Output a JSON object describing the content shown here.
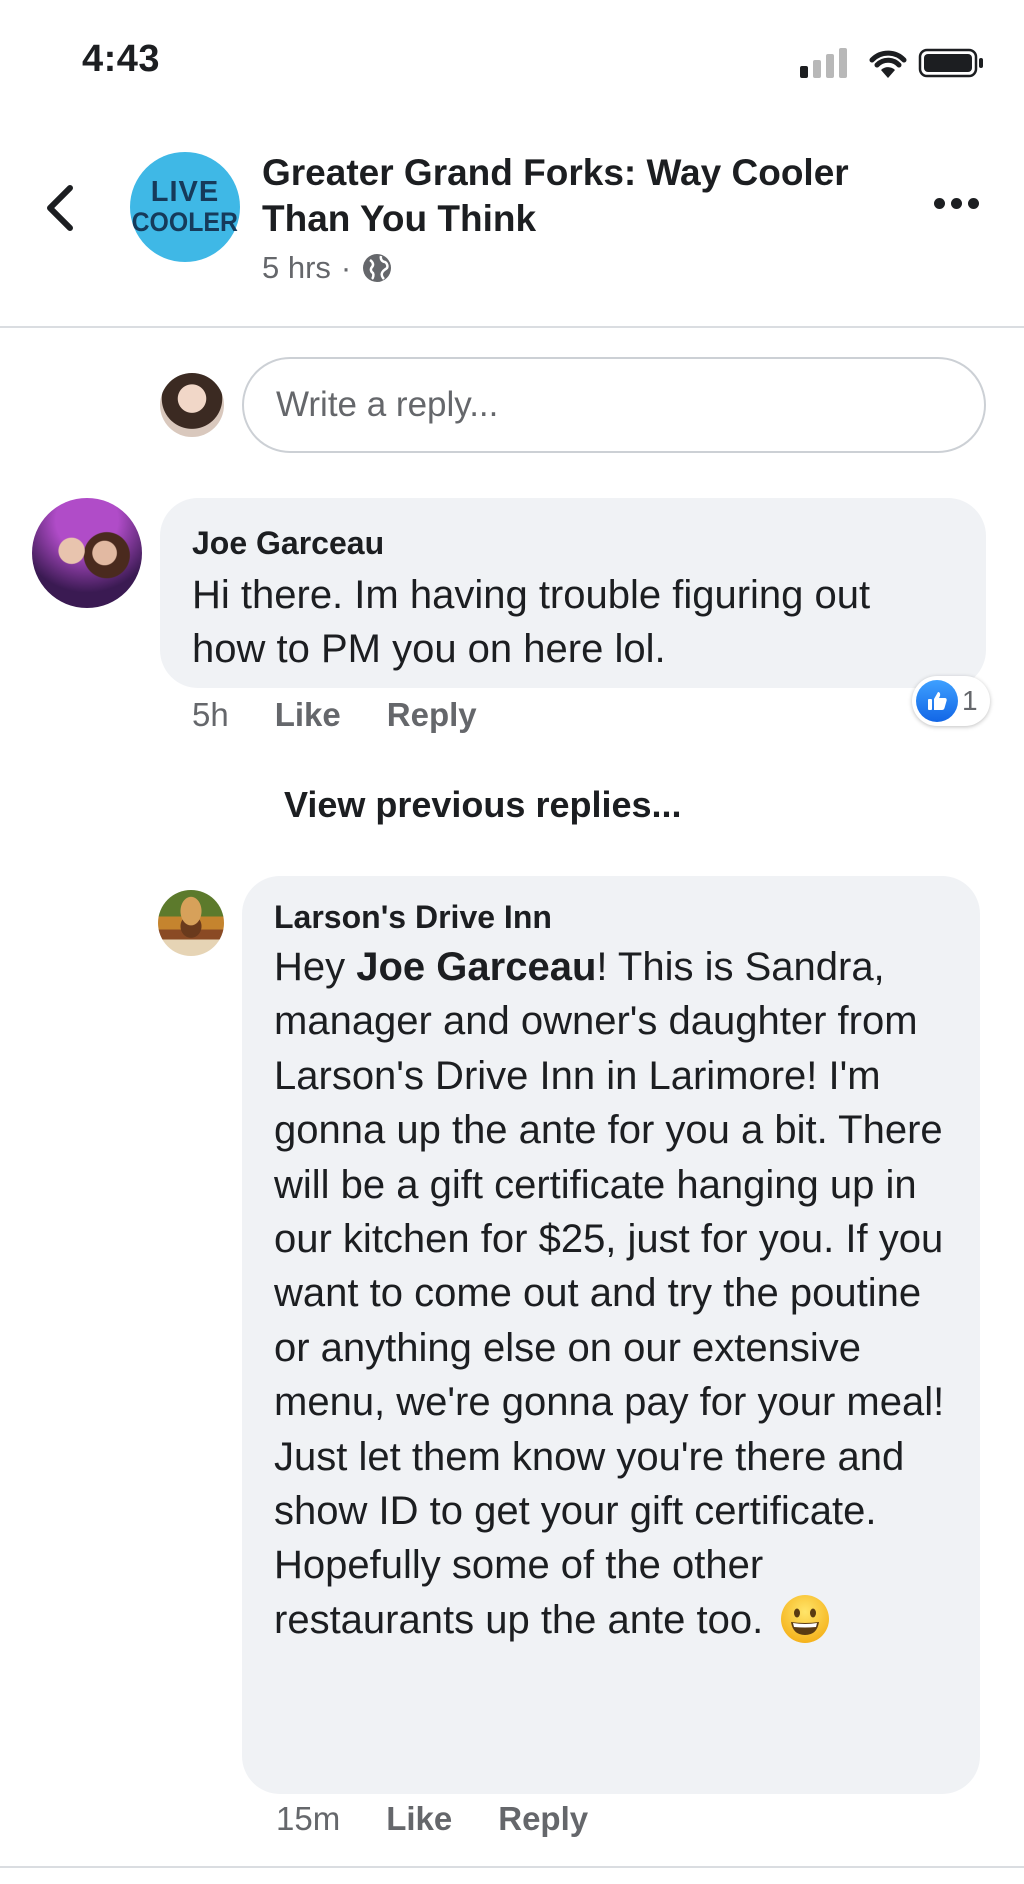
{
  "status_bar": {
    "time": "4:43"
  },
  "header": {
    "avatar_line1": "LIVE",
    "avatar_line2": "COOLER",
    "title": "Greater Grand Forks: Way Cooler Than You Think",
    "time_ago": "5 hrs",
    "separator": "·",
    "audience_icon": "globe-icon"
  },
  "reply_input": {
    "placeholder": "Write a reply..."
  },
  "comments": [
    {
      "author": "Joe Garceau",
      "text": "Hi there. Im having trouble figuring out how to PM you on here lol.",
      "time": "5h",
      "like_label": "Like",
      "reply_label": "Reply",
      "reaction_count": "1"
    }
  ],
  "view_previous": "View previous replies...",
  "reply": {
    "author": "Larson's Drive Inn",
    "greeting": "Hey ",
    "mention": "Joe Garceau",
    "text": "!  This is Sandra, manager and owner's daughter from Larson's Drive Inn in Larimore!  I'm gonna up the ante for you a bit.  There will be a gift certificate hanging up in our kitchen for $25, just for you.  If you want to come out and try the poutine or anything else on our extensive menu, we're gonna pay for your meal!  Just let them know you're there and show ID to get your gift certificate.  Hopefully some of the other restaurants up the ante too.",
    "emoji": "grinning-face",
    "time": "15m",
    "like_label": "Like",
    "reply_label": "Reply"
  },
  "colors": {
    "bubble": "#f0f2f5",
    "secondary_text": "#65676b",
    "like_blue": "#1877f2",
    "page_avatar": "#3fb8e6"
  }
}
